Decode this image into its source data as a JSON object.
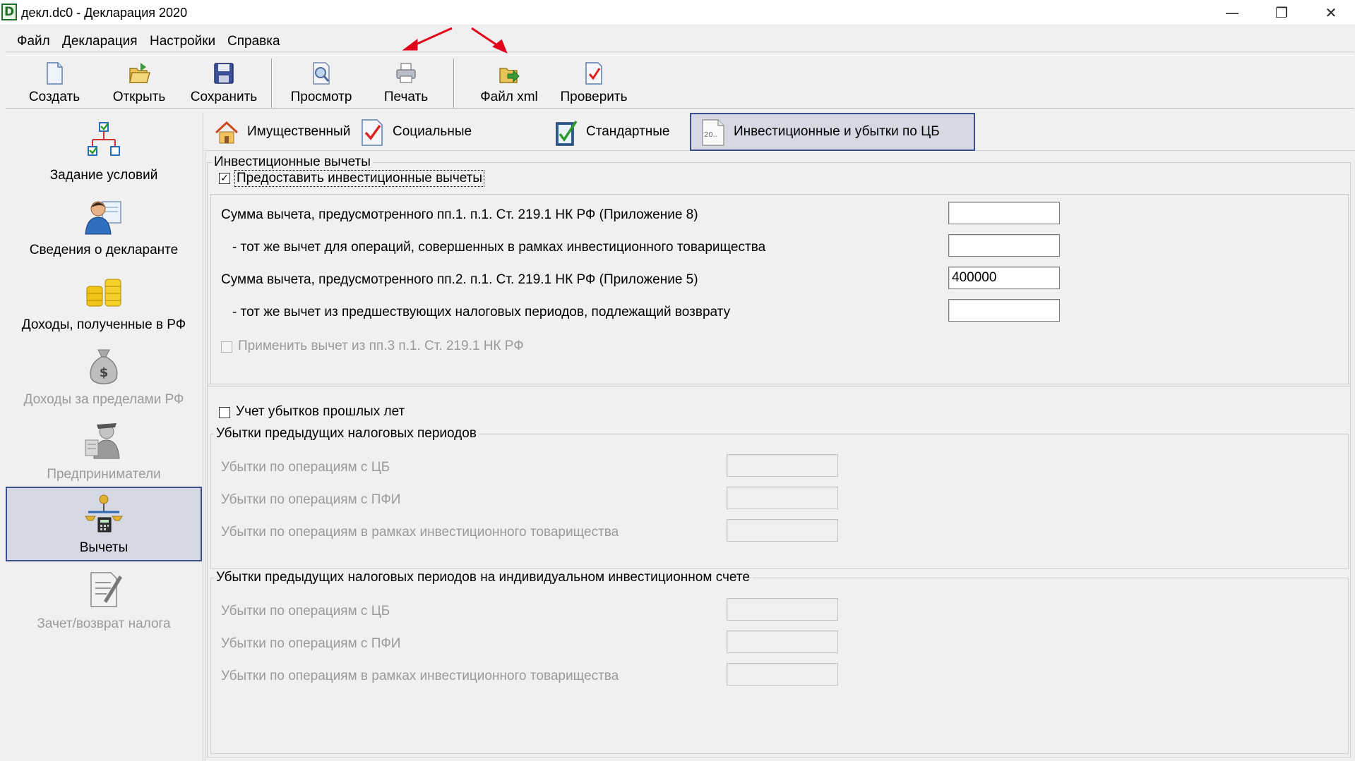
{
  "window": {
    "title": "декл.dc0 - Декларация 2020",
    "app_icon_letter": "D",
    "minimize_glyph": "—",
    "restore_glyph": "❐",
    "close_glyph": "✕"
  },
  "menu": {
    "file": "Файл",
    "declaration": "Декларация",
    "settings": "Настройки",
    "help": "Справка"
  },
  "toolbar": {
    "create": "Создать",
    "open": "Открыть",
    "save": "Сохранить",
    "preview": "Просмотр",
    "print": "Печать",
    "xml_file": "Файл xml",
    "check": "Проверить"
  },
  "sidebar": {
    "items": [
      {
        "label": "Задание условий",
        "icon": "conditions-icon",
        "enabled": true
      },
      {
        "label": "Сведения о декларанте",
        "icon": "declarant-icon",
        "enabled": true
      },
      {
        "label": "Доходы, полученные в РФ",
        "icon": "coins-icon",
        "enabled": true
      },
      {
        "label": "Доходы за пределами РФ",
        "icon": "money-bag-icon",
        "enabled": false
      },
      {
        "label": "Предприниматели",
        "icon": "entrepreneur-icon",
        "enabled": false
      },
      {
        "label": "Вычеты",
        "icon": "deductions-icon",
        "enabled": true
      },
      {
        "label": "Зачет/возврат налога",
        "icon": "tax-return-icon",
        "enabled": false
      }
    ],
    "selected": "Вычеты"
  },
  "tabs": {
    "property": "Имущественный",
    "social": "Социальные",
    "standard": "Стандартные",
    "investment": "Инвестиционные и убытки по ЦБ",
    "investment_icon_text": "20..",
    "active": "Инвестиционные и убытки по ЦБ"
  },
  "investment": {
    "group_title": "Инвестиционные вычеты",
    "provide_checkbox_label": "Предоставить инвестиционные вычеты",
    "provide_checked": true,
    "check_mark": "✓",
    "rows": [
      {
        "label": "Сумма вычета, предусмотренного пп.1. п.1. Ст. 219.1 НК РФ (Приложение 8)",
        "value": ""
      },
      {
        "label": "- тот же вычет для операций, совершенных в рамках инвестиционного товарищества",
        "value": ""
      },
      {
        "label": "Сумма вычета, предусмотренного пп.2. п.1. Ст. 219.1 НК РФ (Приложение 5)",
        "value": "400000"
      },
      {
        "label": "- тот же вычет из предшествующих налоговых периодов, подлежащий возврату",
        "value": ""
      }
    ],
    "apply_checkbox_label": "Применить вычет из пп.3 п.1. Ст. 219.1 НК РФ",
    "apply_checked": false
  },
  "losses": {
    "checkbox_label": "Учет убытков прошлых лет",
    "checked": false,
    "prior_group_title": "Убытки предыдущих налоговых периодов",
    "prior_rows": [
      {
        "label": "Убытки по операциям с ЦБ",
        "value": ""
      },
      {
        "label": "Убытки по операциям с ПФИ",
        "value": ""
      },
      {
        "label": "Убытки по операциям в рамках инвестиционного товарищества",
        "value": ""
      }
    ],
    "iis_group_title": "Убытки предыдущих налоговых периодов на индивидуальном инвестиционном счете",
    "iis_rows": [
      {
        "label": "Убытки по операциям с ЦБ",
        "value": ""
      },
      {
        "label": "Убытки по операциям с ПФИ",
        "value": ""
      },
      {
        "label": "Убытки по операциям в рамках инвестиционного товарищества",
        "value": ""
      }
    ]
  },
  "colors": {
    "selected_bg": "#d6d8e4",
    "selected_border": "#3c4f8c",
    "disabled_text": "#9a9a9a",
    "annotation_arrow": "#e3001b"
  }
}
